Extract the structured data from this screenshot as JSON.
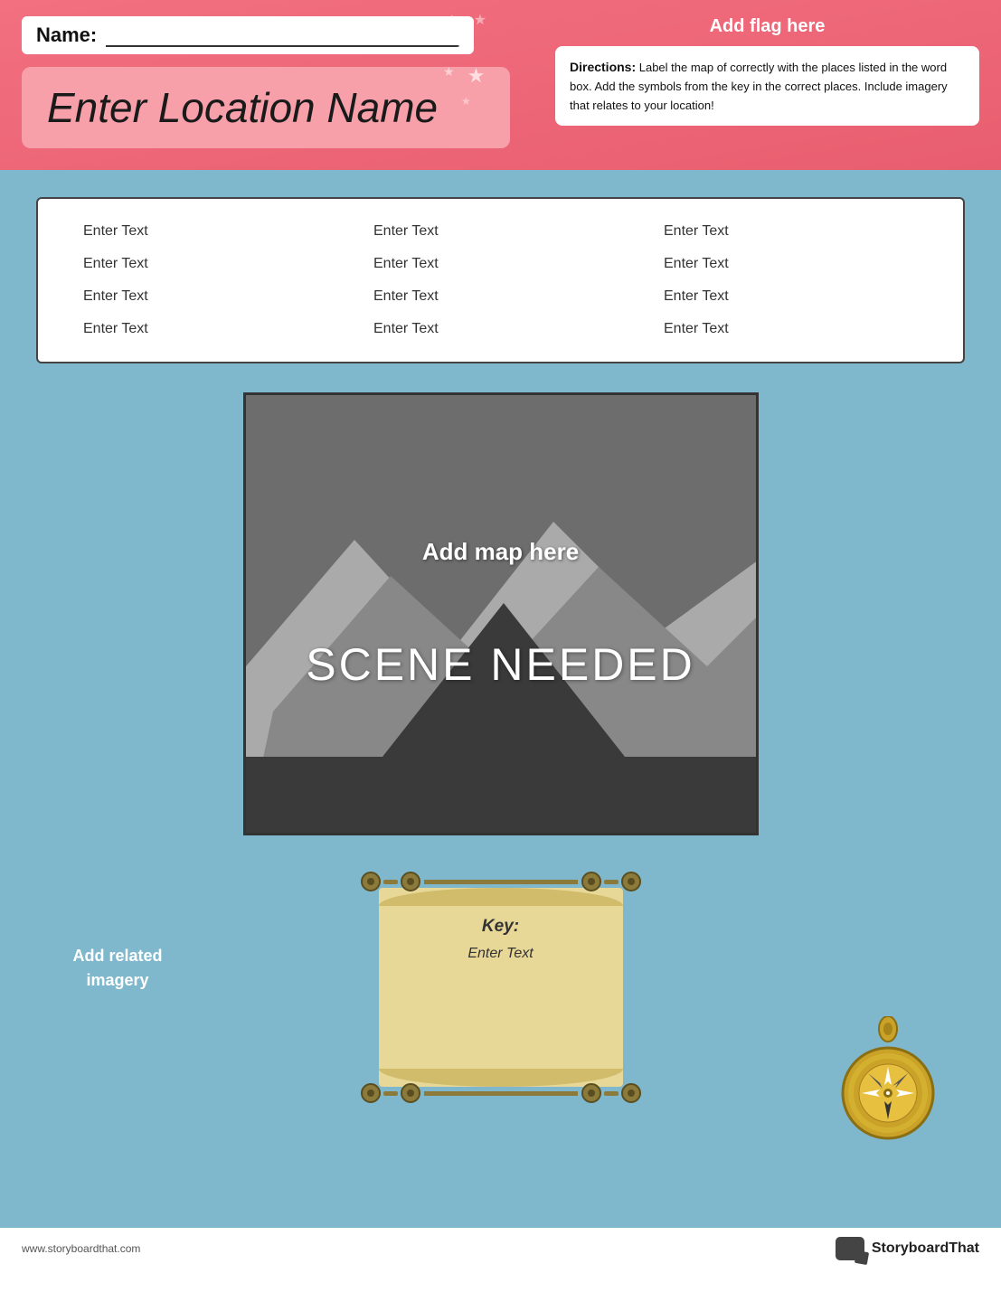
{
  "header": {
    "name_label": "Name:",
    "flag_label": "Add flag here",
    "location_title": "Enter Location Name",
    "directions_label": "Directions:",
    "directions_text": " Label the map of  correctly with the places listed in the word box.  Add the symbols from the key in the correct places. Include imagery that relates to your location!"
  },
  "wordbox": {
    "columns": [
      [
        "Enter Text",
        "Enter Text",
        "Enter Text",
        "Enter Text"
      ],
      [
        "Enter Text",
        "Enter Text",
        "Enter Text",
        "Enter Text"
      ],
      [
        "Enter Text",
        "Enter Text",
        "Enter Text",
        "Enter Text"
      ]
    ]
  },
  "map": {
    "add_map_label": "Add map here",
    "scene_needed_label": "SCENE NEEDED"
  },
  "key": {
    "key_label": "Key:",
    "enter_text_label": "Enter Text"
  },
  "sidebar": {
    "add_imagery_label": "Add related imagery"
  },
  "footer": {
    "url": "www.storyboardthat.com",
    "brand": "StoryboardThat"
  }
}
